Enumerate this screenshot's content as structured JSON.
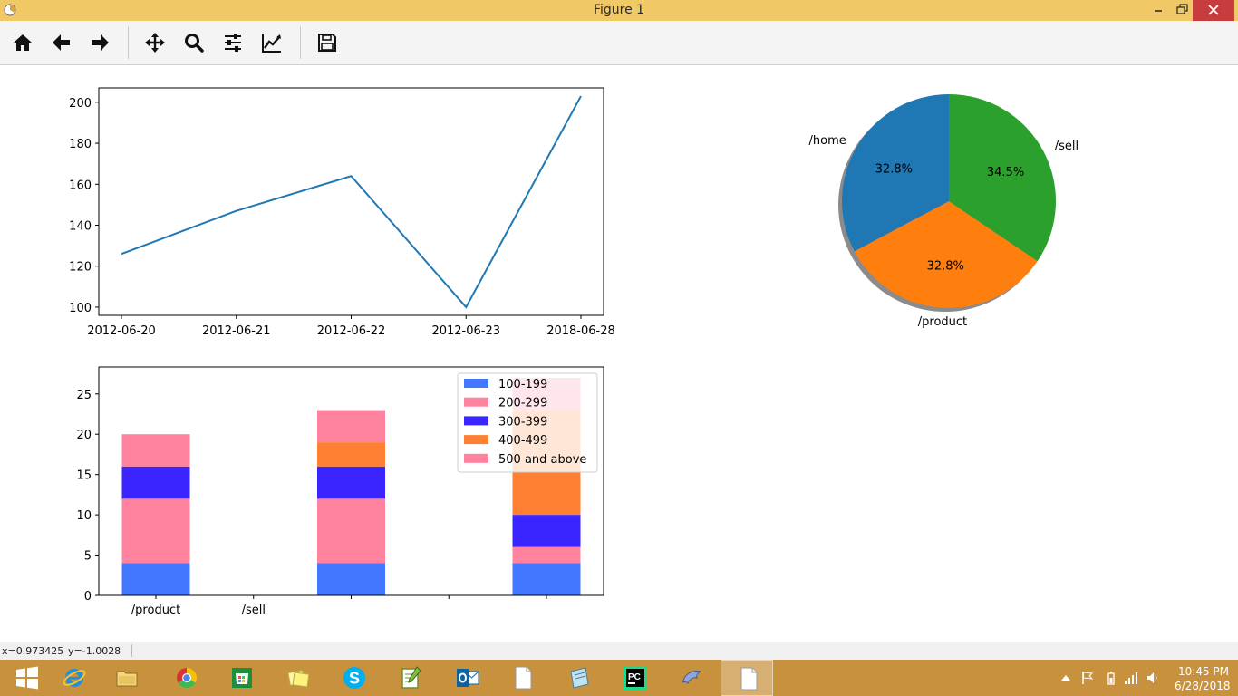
{
  "window": {
    "title": "Figure 1",
    "titlebar_color": "#f0c865"
  },
  "toolbar": {
    "buttons": [
      {
        "name": "home",
        "icon": "home-icon"
      },
      {
        "name": "back",
        "icon": "arrow-left-icon"
      },
      {
        "name": "forward",
        "icon": "arrow-right-icon"
      },
      {
        "name": "pan",
        "icon": "move-icon"
      },
      {
        "name": "zoom",
        "icon": "magnifier-icon"
      },
      {
        "name": "subplots",
        "icon": "sliders-icon"
      },
      {
        "name": "edit-axes",
        "icon": "line-chart-icon"
      },
      {
        "name": "save",
        "icon": "floppy-disk-icon"
      }
    ]
  },
  "chart_data": [
    {
      "type": "line",
      "x": [
        "2012-06-20",
        "2012-06-21",
        "2012-06-22",
        "2012-06-23",
        "2018-06-28"
      ],
      "values": [
        126,
        147,
        164,
        100,
        203
      ],
      "ylim": [
        96,
        207
      ],
      "yticks": [
        "100",
        "120",
        "140",
        "160",
        "180",
        "200"
      ],
      "color": "#1f77b4",
      "grid": false
    },
    {
      "type": "pie",
      "labels": [
        "/home",
        "/product",
        "/sell"
      ],
      "percents": [
        32.8,
        32.8,
        34.5
      ],
      "pct_labels": [
        "32.8%",
        "32.8%",
        "34.5%"
      ],
      "colors": [
        "#1f77b4",
        "#ff7f0e",
        "#2ca02c"
      ],
      "shadow": true
    },
    {
      "type": "bar",
      "stacked": true,
      "tick_labels": [
        "/product",
        "/sell",
        "",
        "",
        ""
      ],
      "ylim": [
        0,
        28.35
      ],
      "yticks": [
        "0",
        "5",
        "10",
        "15",
        "20",
        "25"
      ],
      "legend_position": "upper right",
      "series": [
        {
          "name": "100-199",
          "color": "#4477ff",
          "values": [
            4,
            4,
            4
          ]
        },
        {
          "name": "200-299",
          "color": "#ff829f",
          "values": [
            8,
            8,
            2
          ]
        },
        {
          "name": "300-399",
          "color": "#3a24ff",
          "values": [
            4,
            4,
            4
          ]
        },
        {
          "name": "400-499",
          "color": "#ff8033",
          "values": [
            0,
            3,
            13
          ]
        },
        {
          "name": "500 and above",
          "color": "#ff829f",
          "values": [
            4,
            4,
            4
          ]
        }
      ]
    }
  ],
  "status": {
    "x_readout": "x=0.973425",
    "y_readout": "y=-1.0028"
  },
  "taskbar": {
    "apps": [
      {
        "name": "start",
        "icon": "windows-logo-icon"
      },
      {
        "name": "internet-explorer",
        "icon": "ie-icon"
      },
      {
        "name": "file-explorer",
        "icon": "folder-icon"
      },
      {
        "name": "chrome",
        "icon": "chrome-icon"
      },
      {
        "name": "store",
        "icon": "store-icon"
      },
      {
        "name": "sticky-notes",
        "icon": "sticky-notes-icon"
      },
      {
        "name": "skype",
        "icon": "skype-icon"
      },
      {
        "name": "notepad-plus",
        "icon": "notepad-plus-icon"
      },
      {
        "name": "outlook",
        "icon": "outlook-icon"
      },
      {
        "name": "document",
        "icon": "blank-document-icon"
      },
      {
        "name": "notepad",
        "icon": "notepad-icon"
      },
      {
        "name": "pycharm",
        "icon": "pycharm-icon"
      },
      {
        "name": "mysql-workbench",
        "icon": "dolphin-icon"
      },
      {
        "name": "document-active",
        "icon": "blank-document-icon"
      }
    ],
    "clock_time": "10:45 PM",
    "clock_date": "6/28/2018"
  }
}
